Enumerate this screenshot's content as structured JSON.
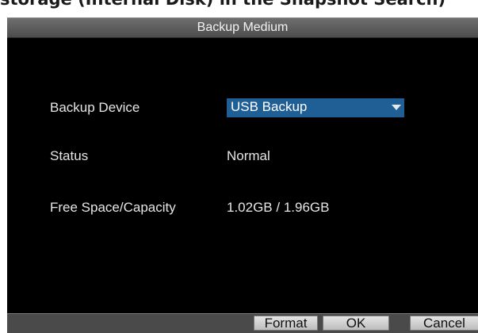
{
  "page_caption": "storage (Internal Disk) in the Snapshot Search)",
  "dialog": {
    "title": "Backup Medium",
    "rows": {
      "backup_device": {
        "label": "Backup Device",
        "value": "USB Backup"
      },
      "status": {
        "label": "Status",
        "value": "Normal"
      },
      "free_space": {
        "label": "Free Space/Capacity",
        "value": "1.02GB / 1.96GB"
      }
    },
    "buttons": {
      "format": "Format",
      "ok": "OK",
      "cancel": "Cancel"
    }
  },
  "colors": {
    "dialog_background": "#000000",
    "selected_field": "#1f5f96",
    "text": "#e6e6e6"
  },
  "icons": {
    "dropdown": "chevron-down-icon"
  }
}
